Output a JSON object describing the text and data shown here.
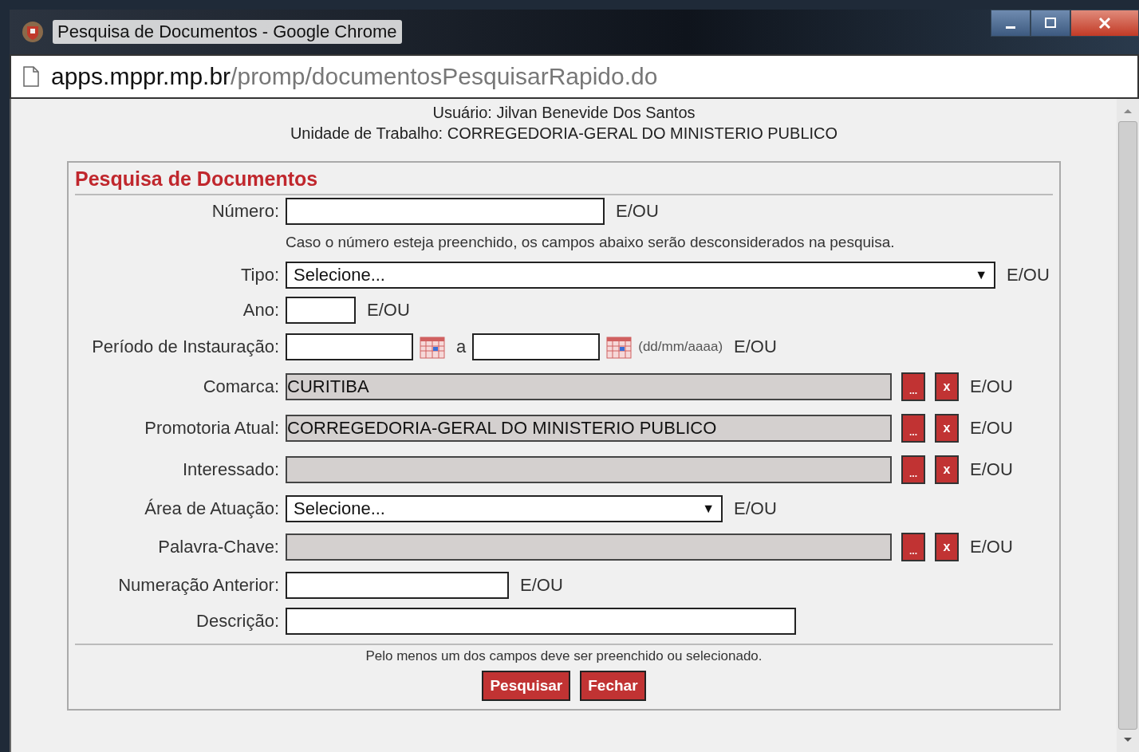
{
  "window": {
    "title": "Pesquisa de Documentos - Google Chrome"
  },
  "address_bar": {
    "host": "apps.mppr.mp.br",
    "path": "/promp/documentosPesquisarRapido.do"
  },
  "header": {
    "user": "Usuário: Jilvan Benevide Dos Santos",
    "unit": "Unidade de Trabalho: CORREGEDORIA-GERAL DO MINISTERIO PUBLICO"
  },
  "form": {
    "title": "Pesquisa de Documentos",
    "rows": [
      {
        "kind": "text",
        "label": "Número:",
        "suffix": "E/OU"
      },
      {
        "kind": "note",
        "text": "Caso o número esteja preenchido, os campos abaixo serão desconsiderados na pesquisa."
      },
      {
        "kind": "select",
        "label": "Tipo:",
        "value": "Selecione...",
        "arrow": "▼",
        "suffix": "E/OU"
      },
      {
        "kind": "text",
        "label": "Ano:",
        "suffix": "E/OU"
      },
      {
        "kind": "date_range",
        "label": "Período de Instauração:",
        "separator": "a",
        "format": "(dd/mm/aaaa)",
        "suffix": "E/OU"
      },
      {
        "kind": "lookup",
        "label": "Comarca:",
        "value": "CURITIBA",
        "browse": "...",
        "clear": "x",
        "suffix": "E/OU"
      },
      {
        "kind": "lookup",
        "label": "Promotoria Atual:",
        "value": "CORREGEDORIA-GERAL DO MINISTERIO PUBLICO",
        "browse": "...",
        "clear": "x",
        "suffix": "E/OU"
      },
      {
        "kind": "lookup",
        "label": "Interessado:",
        "browse": "...",
        "clear": "x",
        "suffix": "E/OU"
      },
      {
        "kind": "select",
        "label": "Área de Atuação:",
        "value": "Selecione...",
        "arrow": "▼",
        "suffix": "E/OU"
      },
      {
        "kind": "lookup",
        "label": "Palavra-Chave:",
        "browse": "...",
        "clear": "x",
        "suffix": "E/OU"
      },
      {
        "kind": "text",
        "label": "Numeração Anterior:",
        "suffix": "E/OU"
      },
      {
        "kind": "text",
        "label": "Descrição:"
      }
    ],
    "footer_note": "Pelo menos um dos campos deve ser preenchido ou selecionado.",
    "buttons": [
      "Pesquisar",
      "Fechar"
    ]
  }
}
